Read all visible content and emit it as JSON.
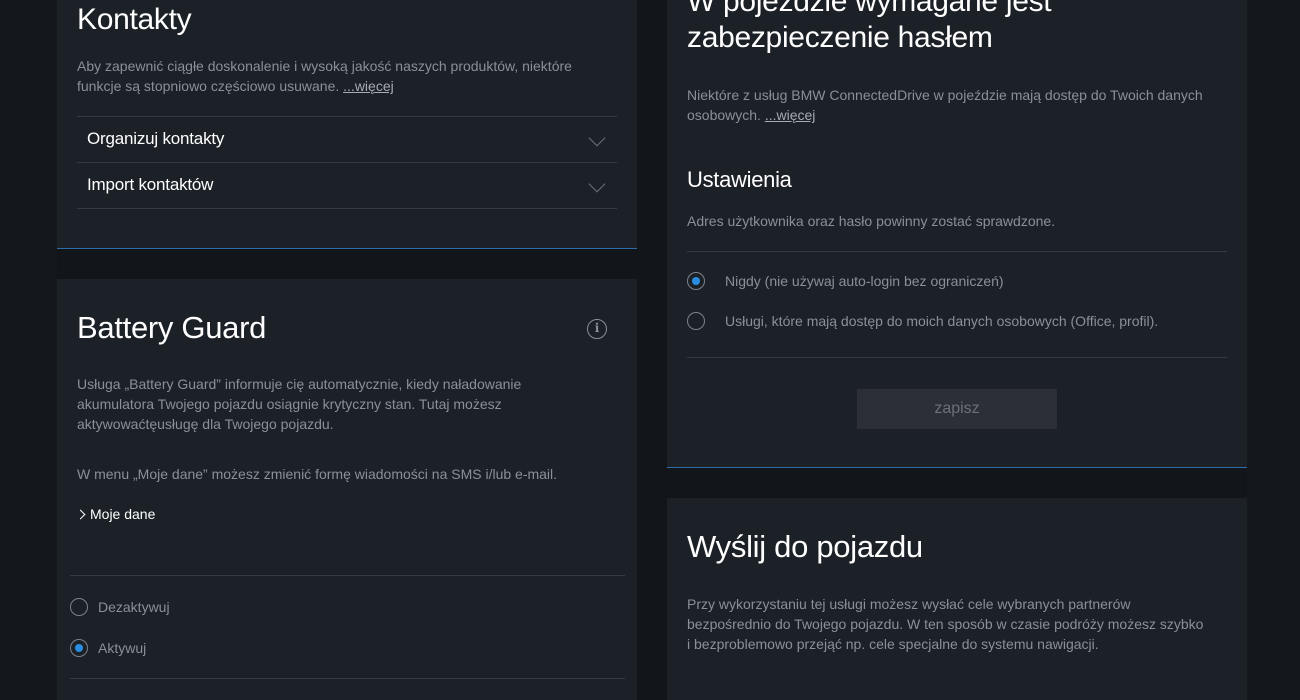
{
  "contacts": {
    "title": "Kontakty",
    "desc": "Aby zapewnić ciągłe doskonalenie i wysoką jakość naszych produktów, niektóre funkcje są stopniowo częściowo usuwane.",
    "more": "...więcej",
    "items": [
      {
        "label": "Organizuj kontakty"
      },
      {
        "label": "Import kontaktów"
      }
    ]
  },
  "battery": {
    "title": "Battery Guard",
    "info_icon": "info-icon",
    "desc": "Usługa „Battery Guard” informuje cię automatycznie, kiedy naładowanie akumulatora Twojego pojazdu osiągnie krytyczny stan. Tutaj możesz aktywowaćtęusługę dla Twojego pojazdu.",
    "desc2": "W menu „Moje dane” możesz zmienić formę wiadomości na SMS i/lub e-mail.",
    "link": "Moje dane",
    "options": [
      {
        "label": "Dezaktywuj",
        "selected": false
      },
      {
        "label": "Aktywuj",
        "selected": true
      }
    ]
  },
  "password": {
    "title_line1": "W pojeździe wymagane jest",
    "title_line2": "zabezpieczenie hasłem",
    "desc": "Niektóre z usług BMW ConnectedDrive w pojeździe mają dostęp do Twoich danych osobowych.",
    "more": "...więcej",
    "settings_title": "Ustawienia",
    "settings_desc": "Adres użytkownika oraz hasło powinny zostać sprawdzone.",
    "options": [
      {
        "label": "Nigdy (nie używaj auto-login bez ograniczeń)",
        "selected": true
      },
      {
        "label": "Usługi, które mają dostęp do moich danych osobowych (Office, profil).",
        "selected": false
      }
    ],
    "save_label": "zapisz"
  },
  "send": {
    "title": "Wyślij do pojazdu",
    "desc": "Przy wykorzystaniu tej usługi możesz wysłać cele wybranych partnerów bezpośrednio do Twojego pojazdu. W ten sposób w czasie podróży możesz szybko i bezproblemowo przejąć np. cele specjalne do systemu nawigacji."
  },
  "colors": {
    "background": "#121519",
    "card": "#1c2027",
    "accent": "#2b8de0",
    "divider": "#353a42",
    "muted_text": "#8b9098"
  }
}
